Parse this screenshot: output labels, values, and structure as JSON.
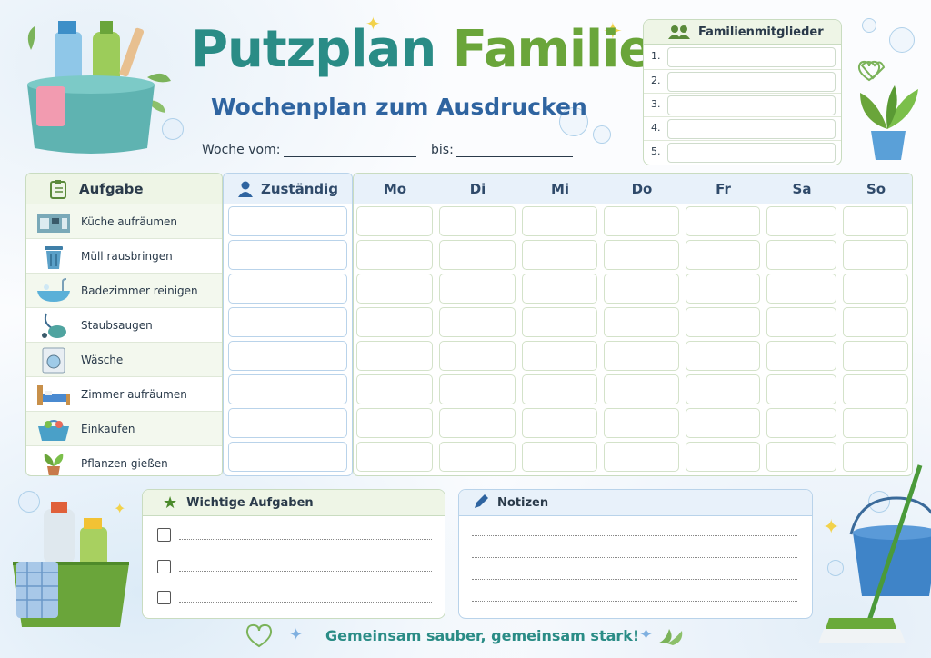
{
  "title": {
    "part1": "Putzplan",
    "part2": "Familie"
  },
  "subtitle": "Wochenplan zum Ausdrucken",
  "week": {
    "from_label": "Woche vom:",
    "to_label": "bis:"
  },
  "members": {
    "title": "Familienmitglieder",
    "rows": [
      "1.",
      "2.",
      "3.",
      "4.",
      "5."
    ]
  },
  "table": {
    "task_header": "Aufgabe",
    "assignee_header": "Zuständig",
    "days": [
      "Mo",
      "Di",
      "Mi",
      "Do",
      "Fr",
      "Sa",
      "So"
    ],
    "tasks": [
      {
        "label": "Küche aufräumen",
        "icon": "kitchen-icon"
      },
      {
        "label": "Müll rausbringen",
        "icon": "trash-can-icon"
      },
      {
        "label": "Badezimmer reinigen",
        "icon": "bathtub-icon"
      },
      {
        "label": "Staubsaugen",
        "icon": "vacuum-icon"
      },
      {
        "label": "Wäsche",
        "icon": "washing-machine-icon"
      },
      {
        "label": "Zimmer aufräumen",
        "icon": "bed-icon"
      },
      {
        "label": "Einkaufen",
        "icon": "shopping-basket-icon"
      },
      {
        "label": "Pflanzen gießen",
        "icon": "plant-icon"
      }
    ]
  },
  "important": {
    "title": "Wichtige Aufgaben"
  },
  "notes": {
    "title": "Notizen"
  },
  "footer": "Gemeinsam sauber, gemeinsam stark!",
  "colors": {
    "teal": "#2a8c86",
    "green": "#6aa53a",
    "blue": "#2f64a0"
  }
}
